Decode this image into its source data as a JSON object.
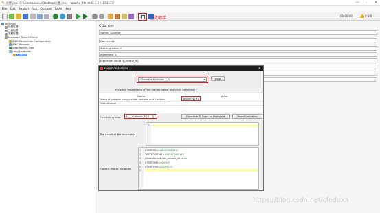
{
  "window": {
    "title": "后置.jmx (C:\\Users\\Lenovo\\Desktop\\后置.jmx) - Apache JMeter (5.1.1 r1855137)",
    "controls": [
      "—",
      "☐",
      "✕"
    ]
  },
  "menu": [
    "File",
    "Edit",
    "Search",
    "Run",
    "Options",
    "Tools",
    "Help"
  ],
  "annotation": "函数助手",
  "status": {
    "timer": "00:00:00",
    "counts": "0  0/0"
  },
  "tree": {
    "items": [
      {
        "label": "Test Plan"
      },
      {
        "label": "后置处理"
      },
      {
        "label": "二级标题"
      },
      {
        "label": "关联处理"
      },
      {
        "label": "teardown Thread Group"
      },
      {
        "label": "JDBC Connection Configuration"
      },
      {
        "label": "JDBC Request"
      },
      {
        "label": "View Results Tree"
      },
      {
        "label": "Loop Controller"
      },
      {
        "label": "Counter"
      }
    ]
  },
  "panel": {
    "title": "Counter",
    "fields": [
      {
        "label": "Name:",
        "value": "Counter"
      },
      {
        "label": "Comments:",
        "value": ""
      },
      {
        "label": "Starting value",
        "value": "1"
      },
      {
        "label": "Increment",
        "value": "1"
      },
      {
        "label": "Maximum value",
        "value": "${phone_N}"
      },
      {
        "label": "",
        "value": ""
      },
      {
        "label": "",
        "value": ""
      },
      {
        "label": "",
        "value": ""
      }
    ]
  },
  "dialog": {
    "title": "Function Helper",
    "choose_label": "Choose a function",
    "choose_value": "__V",
    "help_label": "Help",
    "params_title": "Function Parameters (Fill in Values below and click Generate)",
    "col_name": "Name",
    "col_value": "Value",
    "params": [
      {
        "name": "Name of variable (may include variable and function...",
        "value": "phone_${N}"
      },
      {
        "name": "Default value",
        "value": ""
      }
    ],
    "fs_label": "Function syntax:",
    "fs_value": "${__V(phone_${N},)}",
    "generate_label": "Generate & Copy to clipboard",
    "reset_label": "Reset Variables",
    "result_label": "The result of the function is",
    "result_line": "1",
    "vars_label": "Current JMeter Variables",
    "vars": [
      {
        "n": "1",
        "key": "START.MS",
        "val": "1563472983610"
      },
      {
        "n": "2",
        "key": "TESTSTART.MS",
        "val": "1563472984907"
      },
      {
        "n": "3",
        "key": "JMeterThread.last_sample_ok",
        "val": "true"
      },
      {
        "n": "4",
        "key": "START.HMS",
        "val": "002303"
      },
      {
        "n": "5",
        "key": "START.YMD",
        "val": "20190721"
      },
      {
        "n": "6",
        "key": "",
        "val": ""
      }
    ]
  },
  "watermark": "https://blog.csdn.net/cfeduxa"
}
